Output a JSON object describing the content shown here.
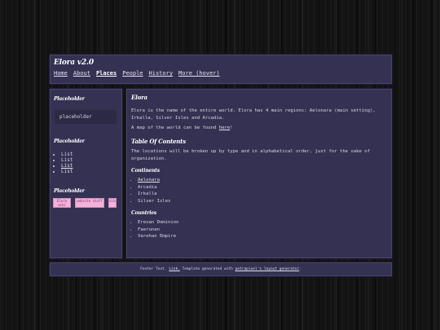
{
  "header": {
    "title": "Elora v2.0",
    "nav": [
      {
        "label": "Home",
        "active": false
      },
      {
        "label": "About",
        "active": false
      },
      {
        "label": "Places",
        "active": true
      },
      {
        "label": "People",
        "active": false
      },
      {
        "label": "History",
        "active": false
      },
      {
        "label": "More (hover)",
        "active": false
      }
    ]
  },
  "sidebar": {
    "heading1": "Placeholder",
    "placeholder_text": "placeholder",
    "heading2": "Placeholder",
    "list": [
      "List",
      "List",
      "List",
      "List"
    ],
    "heading3": "Placeholder",
    "buttons": [
      "Elora wiki",
      "website stuff",
      "site"
    ]
  },
  "main": {
    "title": "Elora",
    "intro": "Elora is the name of the entire world. Elora has 4 main regions: Aelonara (main setting), Irkalla, Silver Isles and Arcadia.",
    "map_prefix": "A map of the world can be found ",
    "map_link": "here",
    "map_suffix": "!",
    "toc_heading": "Table Of Contents",
    "toc_text": "The locations will be broken up by type and in alphabetical order, just for the sake of organization.",
    "continents_heading": "Continents",
    "continents": [
      "Aelonara",
      "Arcadia",
      "Irkalla",
      "Silver Isles"
    ],
    "countries_heading": "Countries",
    "countries": [
      "Erevan Dominion",
      "Faerunan",
      "Varehan Empire"
    ]
  },
  "footer": {
    "prefix": "Footer Text. ",
    "link1": "Link.",
    "middle": " Template generated with ",
    "link2": "petrapixel's layout generator",
    "suffix": "."
  },
  "colors": {
    "background": "#131313",
    "panel": "#353152",
    "panel_border": "#48436a",
    "text": "#d8d4e6",
    "button_pink": "#f1b3d8"
  }
}
